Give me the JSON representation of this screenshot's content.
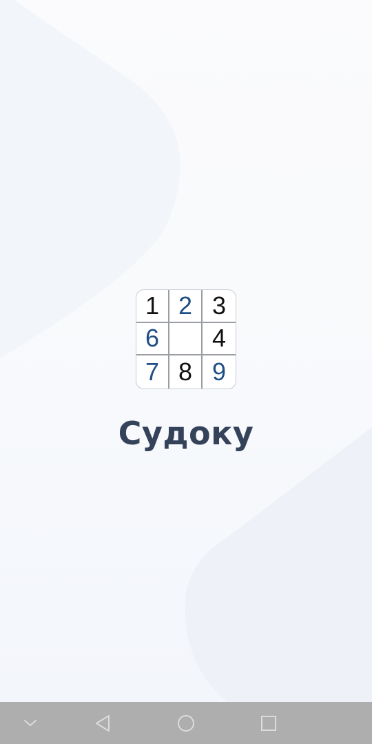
{
  "app": {
    "title": "Судоку"
  },
  "logo": {
    "cells": [
      {
        "value": "1",
        "tone": "black"
      },
      {
        "value": "2",
        "tone": "blue"
      },
      {
        "value": "3",
        "tone": "black"
      },
      {
        "value": "6",
        "tone": "blue"
      },
      {
        "value": "",
        "tone": "black"
      },
      {
        "value": "4",
        "tone": "black"
      },
      {
        "value": "7",
        "tone": "blue"
      },
      {
        "value": "8",
        "tone": "black"
      },
      {
        "value": "9",
        "tone": "blue"
      }
    ]
  },
  "colors": {
    "title": "#34425a",
    "digit_blue": "#1f4e86",
    "digit_black": "#111111",
    "nav_bar": "#aeaeae",
    "nav_icon": "#dcdcdc"
  },
  "nav_bar": {
    "buttons": [
      {
        "icon": "chevron-down-icon"
      },
      {
        "icon": "back-triangle-icon"
      },
      {
        "icon": "home-circle-icon"
      },
      {
        "icon": "recents-square-icon"
      }
    ]
  }
}
